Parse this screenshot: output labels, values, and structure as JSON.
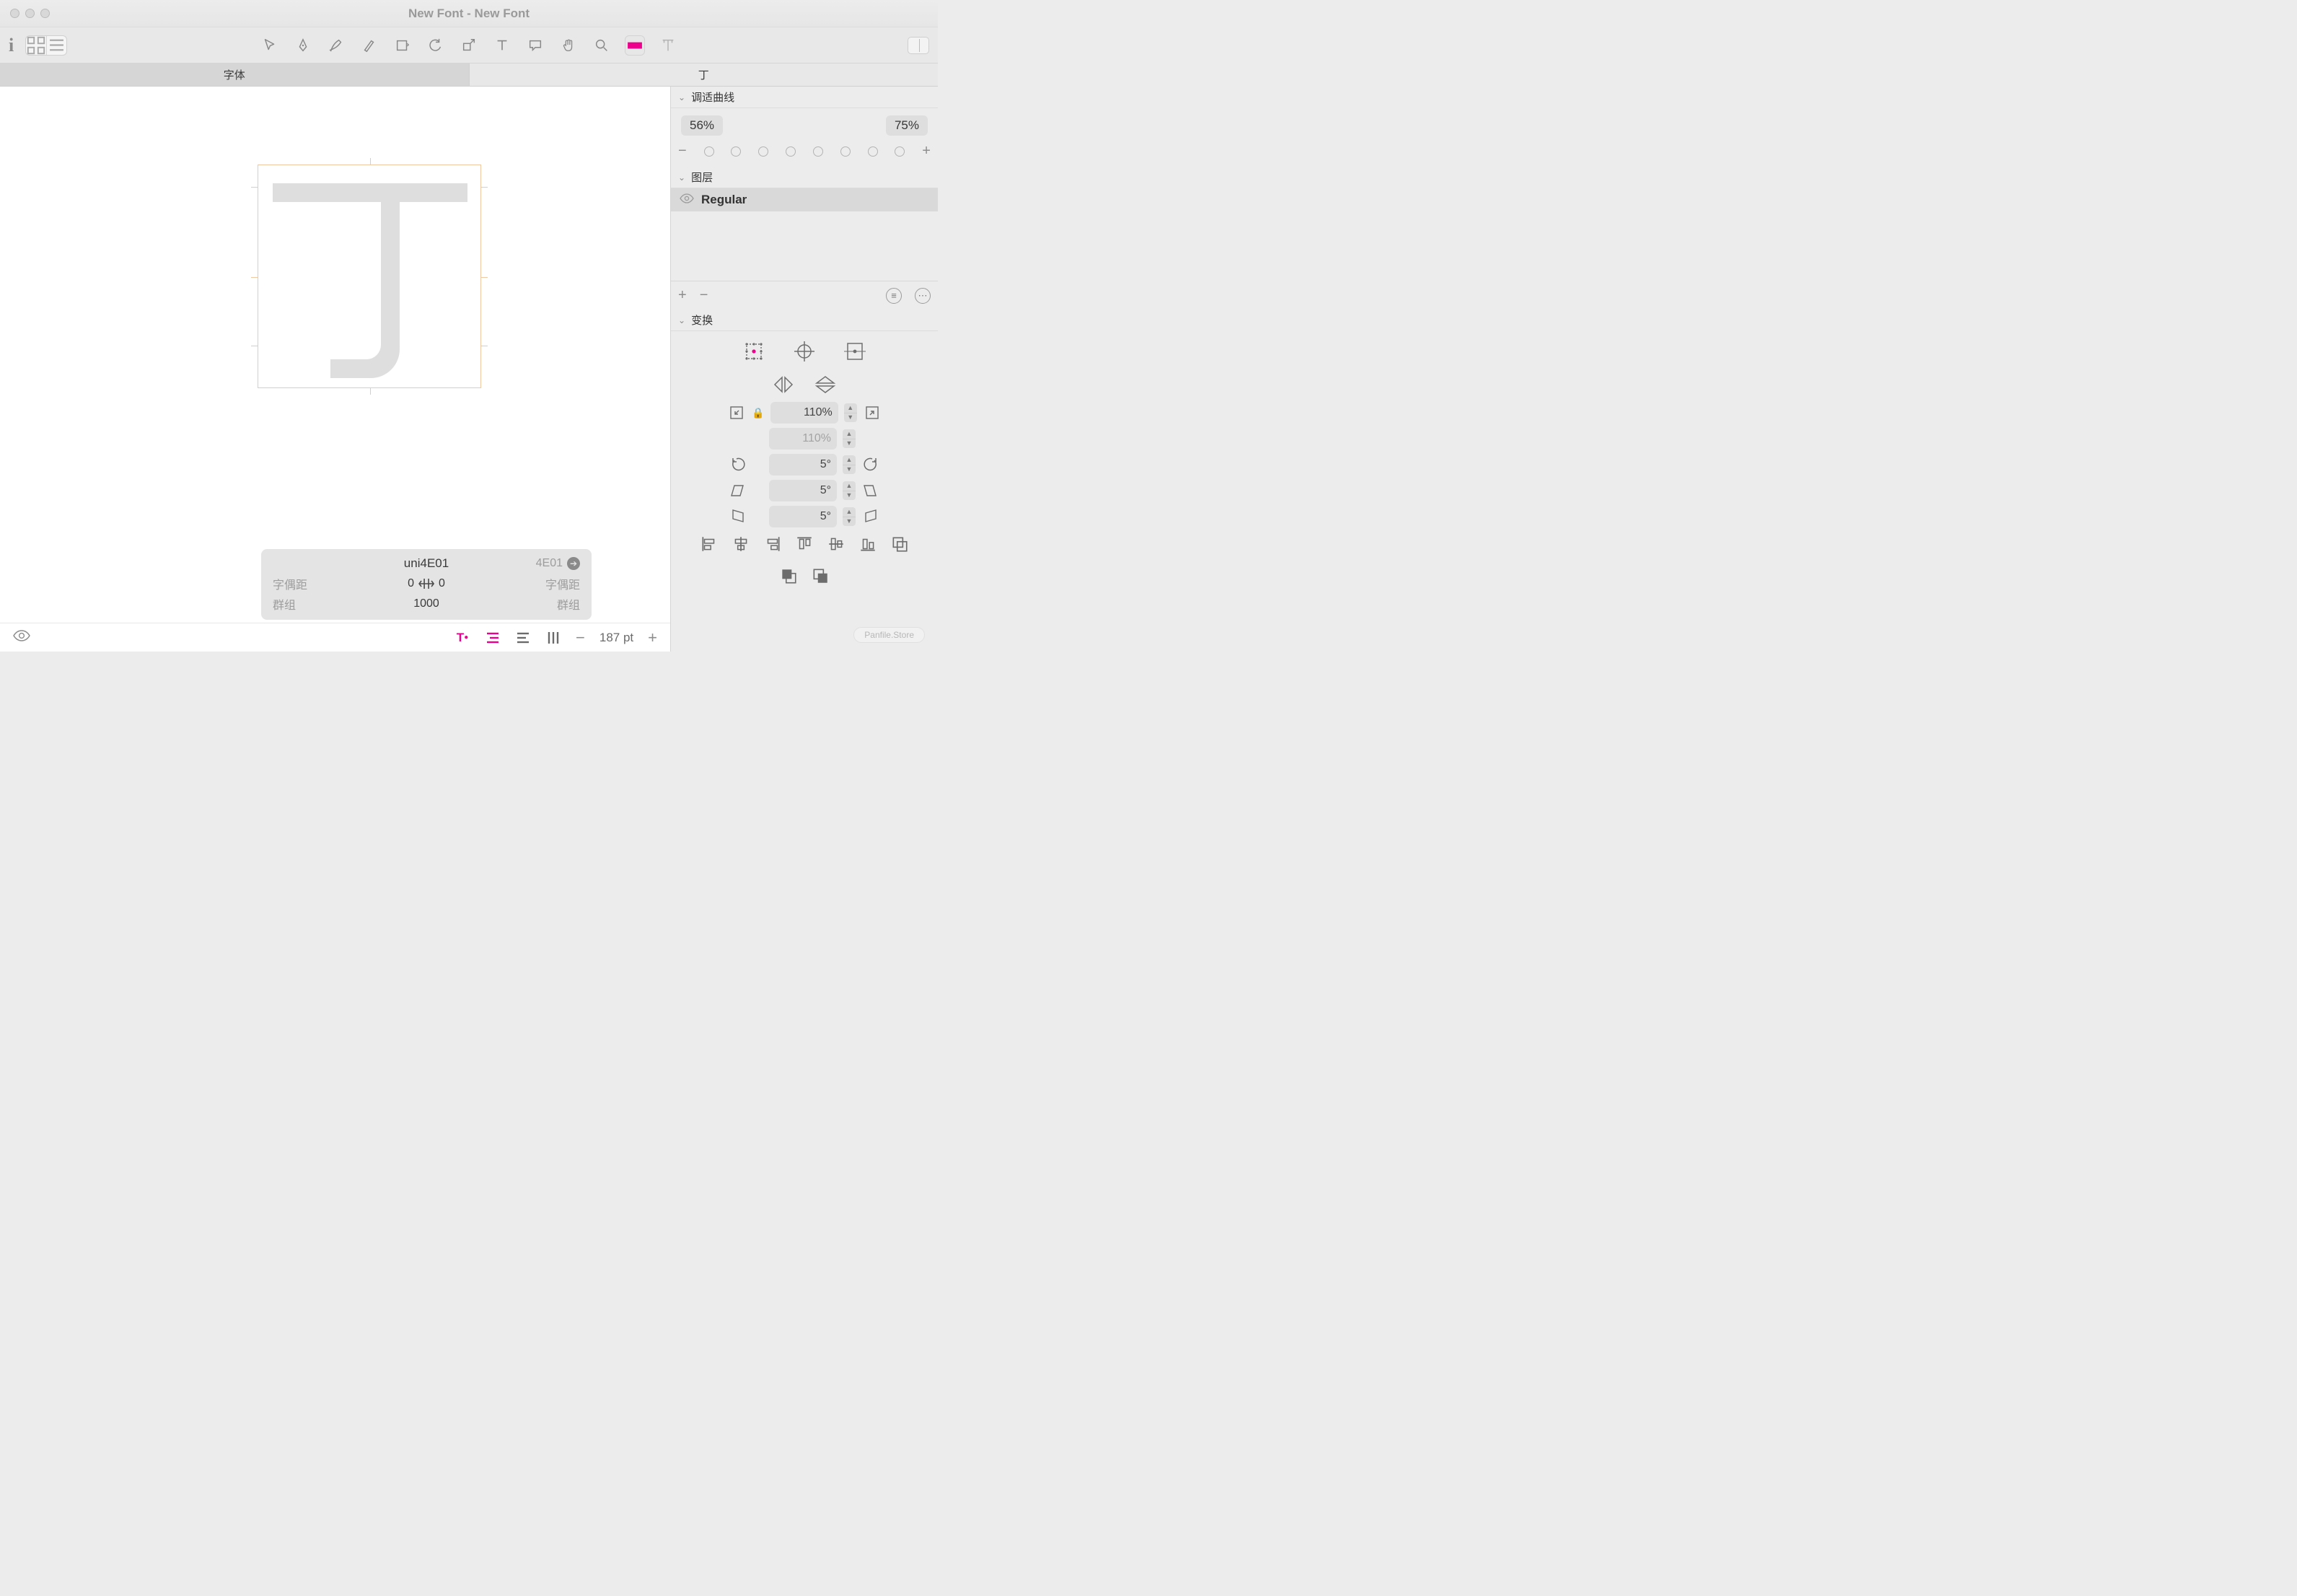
{
  "window": {
    "title": "New Font - New Font"
  },
  "tabs": {
    "font": "字体",
    "glyph": "丁"
  },
  "glyph": {
    "name": "uni4E01",
    "unicode": "4E01",
    "kerning_label_left": "字偶距",
    "kerning_label_right": "字偶距",
    "kerning_left": "0",
    "kerning_right": "0",
    "group_label_left": "群组",
    "group_label_right": "群组",
    "width": "1000"
  },
  "zoom": {
    "value": "187 pt"
  },
  "sidebar": {
    "curves": {
      "title": "调适曲线",
      "left_pct": "56%",
      "right_pct": "75%"
    },
    "layers": {
      "title": "图层",
      "active": "Regular"
    },
    "transform": {
      "title": "变换",
      "scale_x": "110%",
      "scale_y": "110%",
      "rotate": "5°",
      "skew_h": "5°",
      "skew_v": "5°"
    }
  },
  "watermark": "Panfile.Store"
}
